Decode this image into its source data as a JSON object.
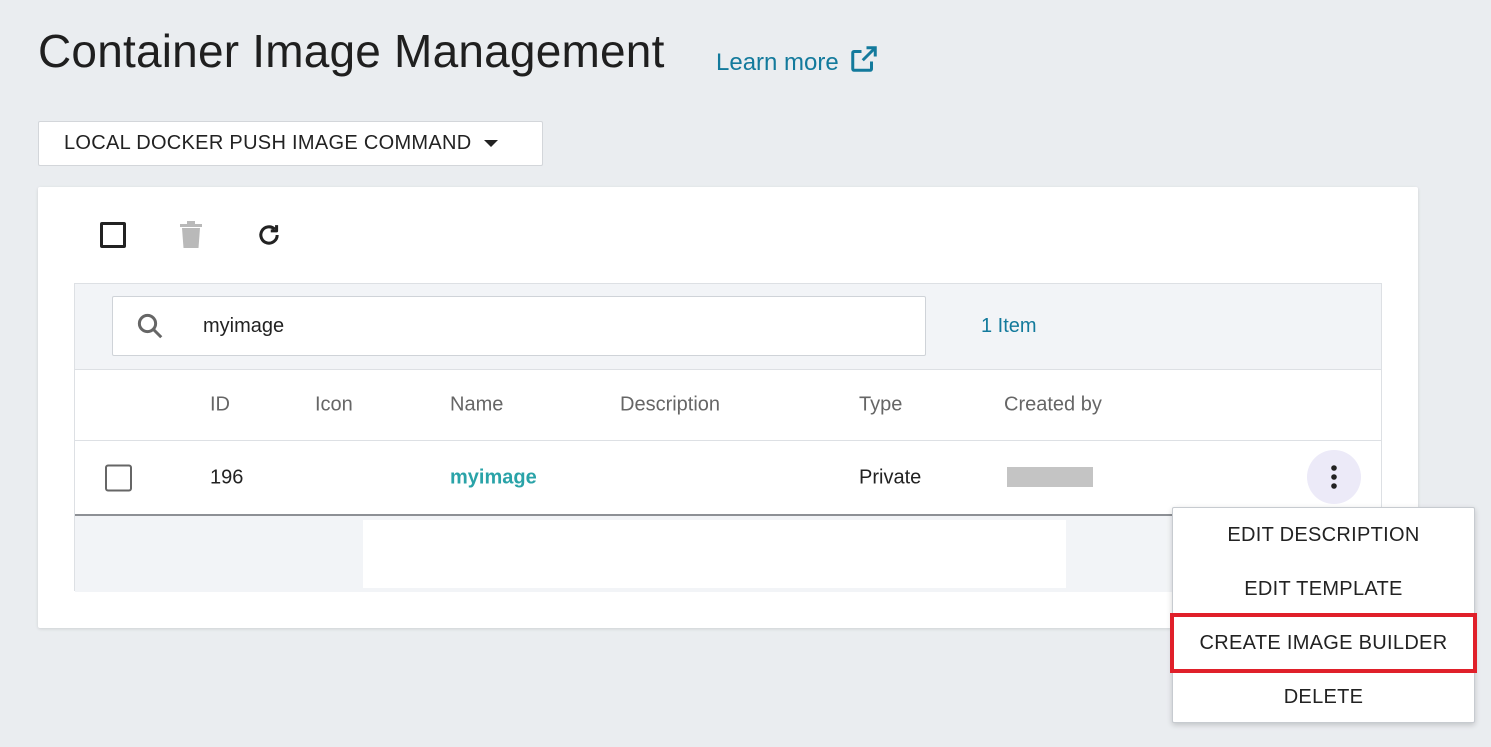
{
  "header": {
    "title": "Container Image Management",
    "learn_more": "Learn more"
  },
  "push_command": {
    "label": "LOCAL DOCKER PUSH IMAGE COMMAND"
  },
  "search": {
    "value": "myimage",
    "item_count": "1 Item"
  },
  "table": {
    "columns": [
      "ID",
      "Icon",
      "Name",
      "Description",
      "Type",
      "Created by"
    ],
    "rows": [
      {
        "id": "196",
        "icon": "",
        "name": "myimage",
        "description": "",
        "type": "Private",
        "created_by": ""
      }
    ]
  },
  "context_menu": {
    "items": [
      "EDIT DESCRIPTION",
      "EDIT TEMPLATE",
      "CREATE IMAGE BUILDER",
      "DELETE"
    ],
    "highlighted": "CREATE IMAGE BUILDER",
    "highlight_color": "#e0202a"
  },
  "colors": {
    "link": "#137a9c",
    "name_link": "#2aa3a8",
    "background": "#eaedf0"
  },
  "icons": {
    "learn_more": "external-link-icon",
    "select_all": "checkbox-icon",
    "delete": "trash-icon",
    "refresh": "refresh-icon",
    "search": "search-icon",
    "row_actions": "kebab-menu-icon"
  }
}
